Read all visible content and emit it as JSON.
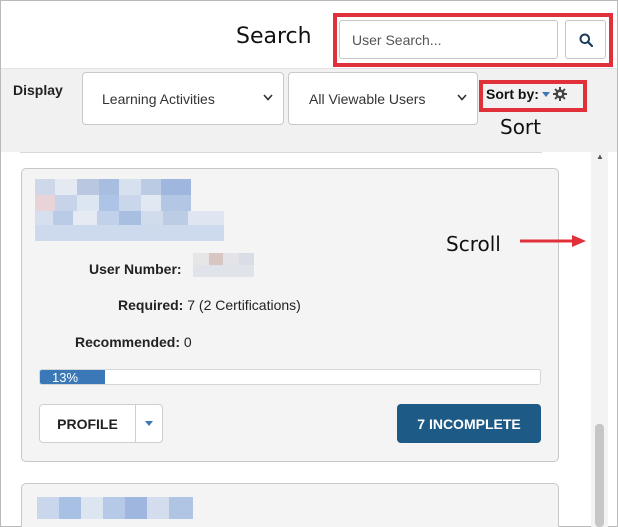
{
  "annotations": {
    "search": "Search",
    "sort": "Sort",
    "scroll": "Scroll",
    "highlight_color": "#e0303a"
  },
  "search": {
    "placeholder": "User Search...",
    "button_icon": "search-icon"
  },
  "filters": {
    "display_label": "Display",
    "activities_selected": "Learning Activities",
    "users_selected": "All Viewable Users",
    "sort_label": "Sort by:",
    "sort_icon": "gear-icon"
  },
  "user_card": {
    "user_number_label": "User Number:",
    "required_label": "Required:",
    "required_value": "7 (2 Certifications)",
    "recommended_label": "Recommended:",
    "recommended_value": "0",
    "progress_percent": 13,
    "progress_text": "13%",
    "profile_label": "PROFILE",
    "incomplete_label": "7 INCOMPLETE",
    "accent_color": "#1d5a86"
  }
}
